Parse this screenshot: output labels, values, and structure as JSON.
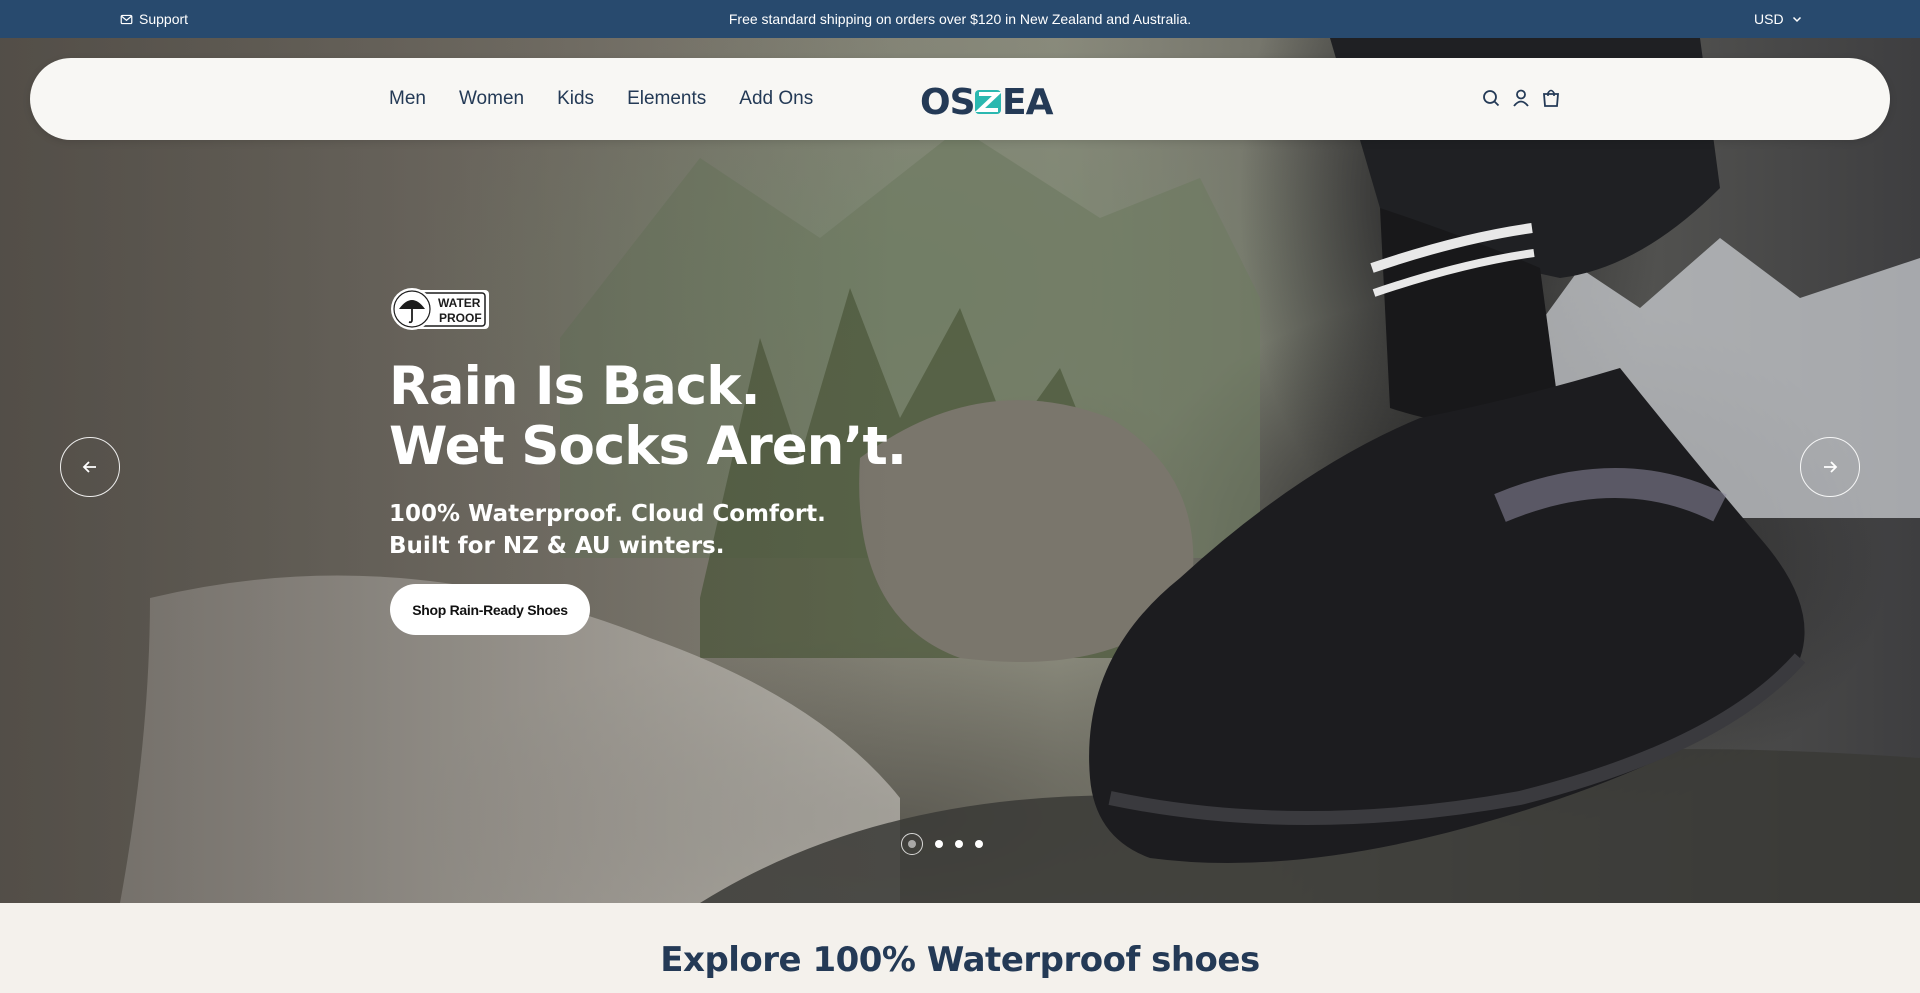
{
  "announcement": {
    "support_label": "Support",
    "message": "Free standard shipping on orders over $120 in New Zealand and Australia.",
    "currency": "USD"
  },
  "nav": {
    "links": [
      "Men",
      "Women",
      "Kids",
      "Elements",
      "Add Ons"
    ],
    "logo_text": "OSZEA",
    "icons": [
      "search-icon",
      "account-icon",
      "cart-icon"
    ]
  },
  "hero": {
    "badge": {
      "line1": "WATER",
      "line2": "PROOF"
    },
    "headline_line1": "Rain Is Back.",
    "headline_line2": "Wet Socks Aren’t.",
    "subline_line1": "100% Waterproof. Cloud Comfort.",
    "subline_line2": "Built for NZ & AU winters.",
    "cta_label": "Shop Rain-Ready Shoes",
    "slides_total": 4,
    "active_slide": 1
  },
  "section": {
    "title": "Explore 100% Waterproof shoes"
  },
  "colors": {
    "brand_navy": "#284a6e",
    "text_navy": "#243a56",
    "logo_teal": "#2bb8b0",
    "section_bg": "#f4f1ec"
  }
}
